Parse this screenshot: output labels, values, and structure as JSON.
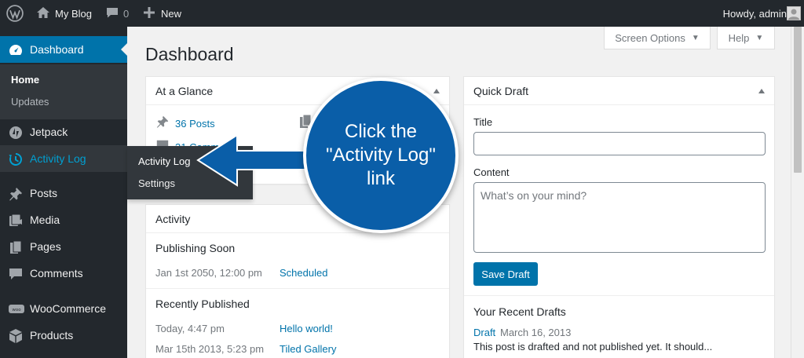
{
  "adminbar": {
    "site_name": "My Blog",
    "comment_count": "0",
    "new_label": "New",
    "howdy": "Howdy, admin"
  },
  "sidebar": {
    "dashboard": "Dashboard",
    "sub_home": "Home",
    "sub_updates": "Updates",
    "jetpack": "Jetpack",
    "activity_log": "Activity Log",
    "posts": "Posts",
    "media": "Media",
    "pages": "Pages",
    "comments": "Comments",
    "woocommerce": "WooCommerce",
    "products": "Products"
  },
  "flyout": {
    "activity_log": "Activity Log",
    "settings": "Settings"
  },
  "screen_meta": {
    "screen_options": "Screen Options",
    "help": "Help"
  },
  "page_title": "Dashboard",
  "at_a_glance": {
    "title": "At a Glance",
    "posts": "36 Posts",
    "comments": "31 Comme"
  },
  "activity": {
    "title": "Activity",
    "publishing_soon": "Publishing Soon",
    "scheduled_date": "Jan 1st 2050, 12:00 pm",
    "scheduled_link": "Scheduled",
    "recently_published": "Recently Published",
    "rows": [
      {
        "date": "Today, 4:47 pm",
        "title": "Hello world!"
      },
      {
        "date": "Mar 15th 2013, 5:23 pm",
        "title": "Tiled Gallery"
      }
    ]
  },
  "quick_draft": {
    "title": "Quick Draft",
    "title_label": "Title",
    "content_label": "Content",
    "content_placeholder": "What’s on your mind?",
    "save_button": "Save Draft",
    "recent_drafts": "Your Recent Drafts",
    "draft_link": "Draft",
    "draft_date": "March 16, 2013",
    "draft_excerpt": "This post is drafted and not published yet. It should..."
  },
  "callout": {
    "line1": "Click the",
    "line2": "\"Activity Log\"",
    "line3": "link"
  },
  "colors": {
    "admin_bar": "#23282d",
    "accent": "#0073aa",
    "callout": "#0a5ea8"
  }
}
